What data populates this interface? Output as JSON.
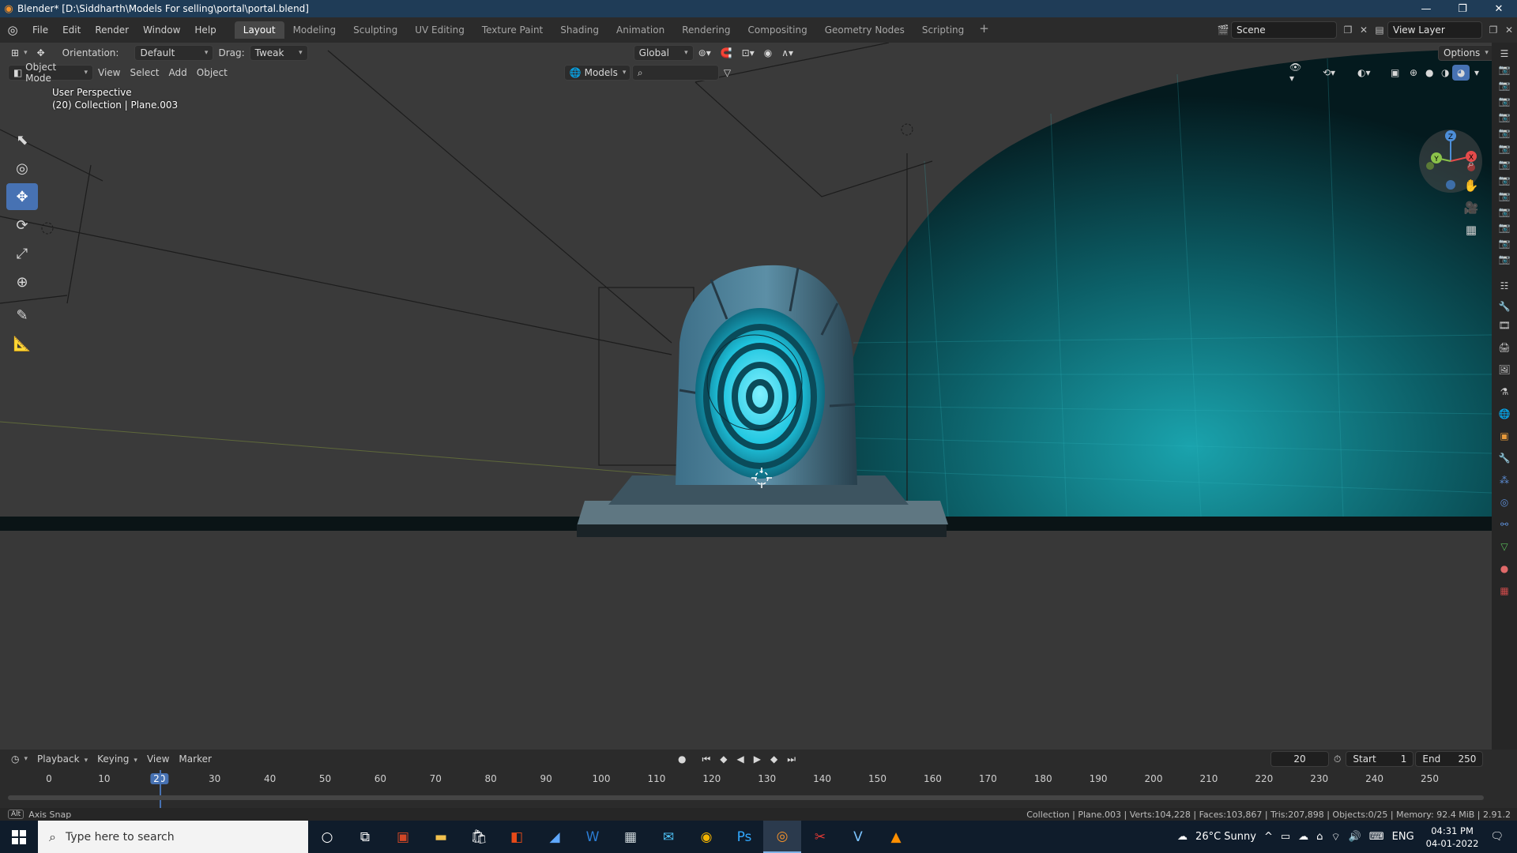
{
  "window": {
    "title": "Blender* [D:\\Siddharth\\Models For selling\\portal\\portal.blend]",
    "minimize": "—",
    "maximize": "❐",
    "close": "✕"
  },
  "menu": [
    "File",
    "Edit",
    "Render",
    "Window",
    "Help"
  ],
  "workspaces": [
    "Layout",
    "Modeling",
    "Sculpting",
    "UV Editing",
    "Texture Paint",
    "Shading",
    "Animation",
    "Rendering",
    "Compositing",
    "Geometry Nodes",
    "Scripting"
  ],
  "active_workspace": "Layout",
  "scene": {
    "name": "Scene",
    "view_layer": "View Layer"
  },
  "tool_header": {
    "orientation_label": "Orientation:",
    "orientation_value": "Default",
    "drag_label": "Drag:",
    "drag_value": "Tweak",
    "transform_orientation": "Global",
    "options": "Options"
  },
  "viewport_header": {
    "mode": "Object Mode",
    "menus": [
      "View",
      "Select",
      "Add",
      "Object"
    ],
    "asset_library": "Models"
  },
  "viewport_overlay": {
    "line1": "User Perspective",
    "line2": "(20) Collection | Plane.003"
  },
  "gizmo": {
    "z": "Z",
    "y": "Y",
    "x": "X"
  },
  "timeline": {
    "menus": [
      "Playback",
      "Keying",
      "View",
      "Marker"
    ],
    "current_frame": "20",
    "start_label": "Start",
    "start_value": "1",
    "end_label": "End",
    "end_value": "250",
    "ticks": [
      "0",
      "10",
      "20",
      "30",
      "40",
      "50",
      "60",
      "70",
      "80",
      "90",
      "100",
      "110",
      "120",
      "130",
      "140",
      "150",
      "160",
      "170",
      "180",
      "190",
      "200",
      "210",
      "220",
      "230",
      "240",
      "250"
    ]
  },
  "status": {
    "key": "Alt",
    "hint": "Axis Snap",
    "stats": "Collection | Plane.003 | Verts:104,228 | Faces:103,867 | Tris:207,898 | Objects:0/25 | Memory: 92.4 MiB | 2.91.2"
  },
  "taskbar": {
    "search_placeholder": "Type here to search",
    "weather": "26°C  Sunny",
    "lang": "ENG",
    "time": "04:31 PM",
    "date": "04-01-2022"
  },
  "colors": {
    "accent": "#4772b3",
    "portal_cyan": "#1fc6e0",
    "titlebar": "#1f3c57"
  }
}
